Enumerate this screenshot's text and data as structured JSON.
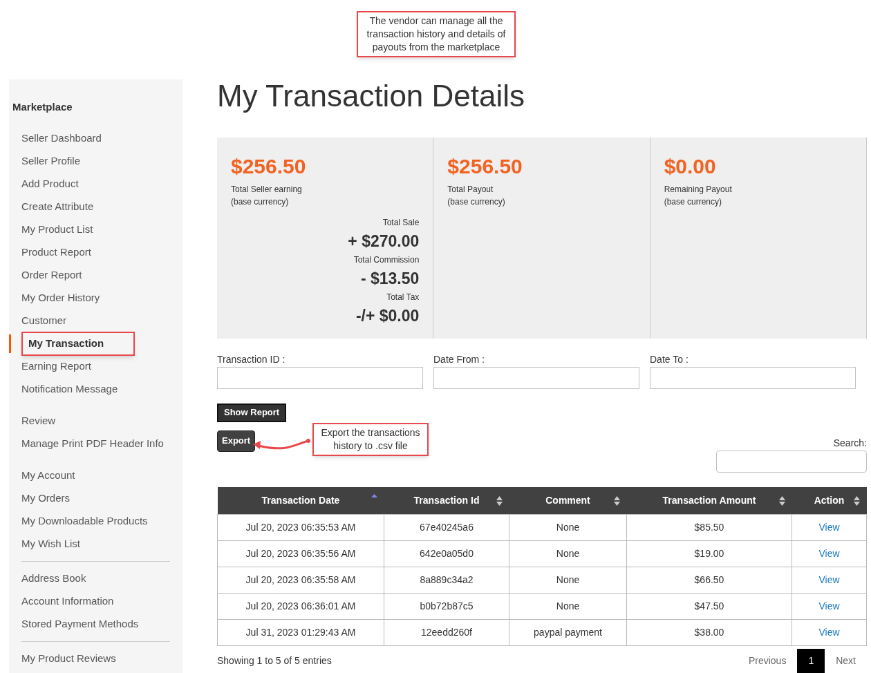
{
  "callouts": [
    {
      "kind": "top",
      "text": "The vendor can manage all the transaction history and details of payouts from the marketplace"
    },
    {
      "kind": "export",
      "text": "Export the transactions history to .csv file"
    }
  ],
  "sidebar": {
    "heading": "Marketplace",
    "groups": [
      {
        "kind": "plain",
        "items": [
          {
            "label": "Seller Dashboard",
            "selected": false
          },
          {
            "label": "Seller Profile",
            "selected": false
          },
          {
            "label": "Add Product",
            "selected": false
          },
          {
            "label": "Create Attribute",
            "selected": false
          },
          {
            "label": "My Product List",
            "selected": false
          },
          {
            "label": "Product Report",
            "selected": false
          },
          {
            "label": "Order Report",
            "selected": false
          },
          {
            "label": "My Order History",
            "selected": false
          },
          {
            "label": "Customer",
            "selected": false
          },
          {
            "label": "My Transaction",
            "selected": true
          },
          {
            "label": "Earning Report",
            "selected": false
          },
          {
            "label": "Notification Message",
            "selected": false
          }
        ]
      },
      {
        "kind": "spaced",
        "items": [
          {
            "label": "Review",
            "selected": false
          },
          {
            "label": "Manage Print PDF Header Info",
            "selected": false
          }
        ]
      },
      {
        "kind": "spaced",
        "items": [
          {
            "label": "My Account",
            "selected": false
          },
          {
            "label": "My Orders",
            "selected": false
          },
          {
            "label": "My Downloadable Products",
            "selected": false
          },
          {
            "label": "My Wish List",
            "selected": false
          }
        ]
      },
      {
        "kind": "ruled",
        "items": [
          {
            "label": "Address Book",
            "selected": false
          },
          {
            "label": "Account Information",
            "selected": false
          },
          {
            "label": "Stored Payment Methods",
            "selected": false
          }
        ]
      },
      {
        "kind": "ruled",
        "items": [
          {
            "label": "My Product Reviews",
            "selected": false
          }
        ]
      }
    ]
  },
  "page_title": "My Transaction Details",
  "summary": [
    {
      "amount": "$256.50",
      "label": "Total Seller earning",
      "note": "(base currency)",
      "breakdown": [
        {
          "label": "Total Sale",
          "value": "+ $270.00"
        },
        {
          "label": "Total Commission",
          "value": "- $13.50"
        },
        {
          "label": "Total Tax",
          "value": "-/+ $0.00"
        }
      ]
    },
    {
      "amount": "$256.50",
      "label": "Total Payout",
      "note": "(base currency)"
    },
    {
      "amount": "$0.00",
      "label": "Remaining Payout",
      "note": "(base currency)"
    }
  ],
  "filters": [
    {
      "label": "Transaction ID :"
    },
    {
      "label": "Date From :"
    },
    {
      "label": "Date To :"
    }
  ],
  "show_report_button": "Show Report",
  "export_button": "Export",
  "search_label": "Search:",
  "table": {
    "columns": [
      {
        "label": "Transaction Date",
        "sorted": true
      },
      {
        "label": "Transaction Id",
        "sorted": false
      },
      {
        "label": "Comment",
        "sorted": false
      },
      {
        "label": "Transaction Amount",
        "sorted": false
      },
      {
        "label": "Action",
        "sorted": false
      }
    ],
    "rows": [
      [
        "Jul 20, 2023 06:35:53 AM",
        "67e40245a6",
        "None",
        "$85.50",
        "View"
      ],
      [
        "Jul 20, 2023 06:35:56 AM",
        "642e0a05d0",
        "None",
        "$19.00",
        "View"
      ],
      [
        "Jul 20, 2023 06:35:58 AM",
        "8a889c34a2",
        "None",
        "$66.50",
        "View"
      ],
      [
        "Jul 20, 2023 06:36:01 AM",
        "b0b72b87c5",
        "None",
        "$47.50",
        "View"
      ],
      [
        "Jul 31, 2023 01:29:43 AM",
        "12eedd260f",
        "paypal payment",
        "$38.00",
        "View"
      ]
    ]
  },
  "entries_info": "Showing 1 to 5 of 5 entries",
  "pagination": [
    {
      "label": "Previous",
      "selected": false
    },
    {
      "label": "1",
      "selected": true
    },
    {
      "label": "Next",
      "selected": false
    }
  ]
}
